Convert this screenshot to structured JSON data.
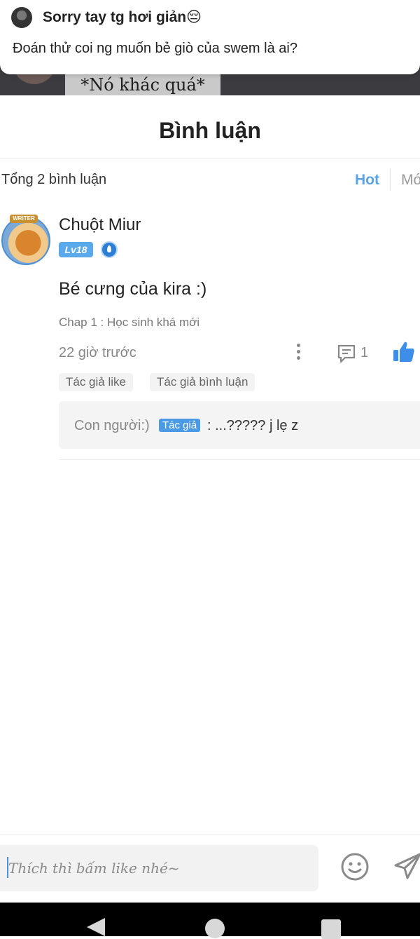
{
  "notification": {
    "title": "Sorry tay tg hơi giản😔",
    "body": "Đoán thử coi ng muốn bẻ giò của swem là ai?"
  },
  "background": {
    "caption": "*Nó khác quá*"
  },
  "header": {
    "title": "Bình luận",
    "total": "Tổng 2 bình luận",
    "sort_hot": "Hot",
    "sort_new": "Mớ"
  },
  "comment": {
    "avatar_tag": "WRITER",
    "username": "Chuột Miur",
    "level": "Lv18",
    "text": "Bé cưng của kira :)",
    "chapter": "Chap 1 : Học sinh khá mới",
    "time": "22 giờ trước",
    "reply_count": "1",
    "chips": [
      "Tác giả like",
      "Tác giả bình luận"
    ],
    "reply": {
      "author": "Con người:)",
      "author_tag": "Tác giả",
      "text": ": ...????? j lẹ z"
    }
  },
  "composer": {
    "placeholder": "Thích thì bấm like nhé~"
  },
  "colors": {
    "accent": "#5aa3e6",
    "like": "#3d8ee8",
    "author_tag": "#4a9ae6"
  },
  "icons": [
    "more-vertical-icon",
    "reply-icon",
    "thumbs-up-icon",
    "emoji-icon",
    "send-icon",
    "back-icon",
    "home-icon",
    "recent-apps-icon"
  ]
}
